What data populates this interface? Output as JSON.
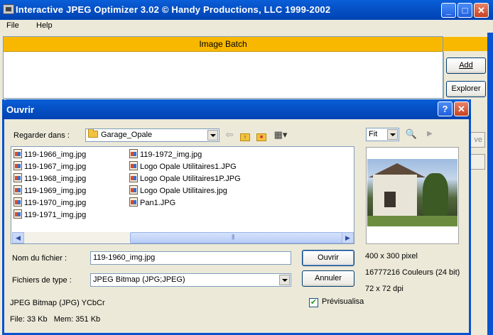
{
  "main_window": {
    "title": "Interactive JPEG Optimizer 3.02 © Handy Productions, LLC 1999-2002",
    "menu": [
      "File",
      "Help"
    ],
    "batch_header": "Image Batch",
    "side_buttons": [
      "Add",
      "Explorer"
    ],
    "partial_buttons": [
      "ve"
    ]
  },
  "dialog": {
    "title": "Ouvrir",
    "look_in_label": "Regarder dans :",
    "look_in_value": "Garage_Opale",
    "files_col1": [
      "119-1966_img.jpg",
      "119-1967_img.jpg",
      "119-1968_img.jpg",
      "119-1969_img.jpg",
      "119-1970_img.jpg",
      "119-1971_img.jpg"
    ],
    "files_col2": [
      "119-1972_img.jpg",
      "Logo Opale Utilitaires1.JPG",
      "Logo Opale Utilitaires1P.JPG",
      "Logo Opale Utilitaires.jpg",
      "Pan1.JPG"
    ],
    "filename_label": "Nom du fichier :",
    "filename_value": "119-1960_img.jpg",
    "filetype_label": "Fichiers de type :",
    "filetype_value": "JPEG Bitmap (JPG;JPEG)",
    "open_button": "Ouvrir",
    "cancel_button": "Annuler",
    "zoom_value": "Fit",
    "image_size": "400 x 300 pixel",
    "image_colors": "16777216 Couleurs (24 bit)",
    "image_dpi": "72 x 72 dpi",
    "preview_label": "Prévisualisa",
    "preview_checked": true,
    "format_info": "JPEG Bitmap (JPG) YCbCr",
    "file_info": "File: 33 Kb   Mem: 351 Kb"
  },
  "colors": {
    "titlebar": "#0652c8",
    "batch_header": "#f8b800",
    "face": "#ece9d8"
  }
}
